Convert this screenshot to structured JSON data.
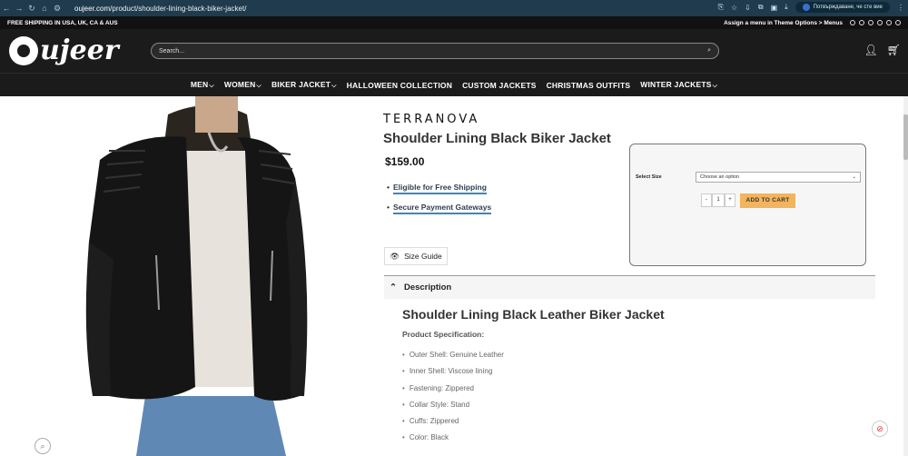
{
  "browser": {
    "url_host": "oujeer.com",
    "url_path": "/product/shoulder-lining-black-biker-jacket/",
    "profile_label": "Потвърждаване, че сте вие"
  },
  "topbar": {
    "shipping": "FREE SHIPPING IN USA, UK, CA & AUS",
    "menu_note": "Assign a menu in Theme Options > Menus"
  },
  "header": {
    "logo_text": "ujeer",
    "search_placeholder": "Search..."
  },
  "nav": {
    "items": [
      {
        "label": "MEN",
        "arrow": "⌵"
      },
      {
        "label": "WOMEN",
        "arrow": "⌵"
      },
      {
        "label": "BIKER JACKET",
        "arrow": "⌵"
      },
      {
        "label": "HALLOWEEN COLLECTION",
        "arrow": ""
      },
      {
        "label": "CUSTOM JACKETS",
        "arrow": ""
      },
      {
        "label": "CHRISTMAS OUTFITS",
        "arrow": ""
      },
      {
        "label": "WINTER JACKETS",
        "arrow": "⌵"
      }
    ]
  },
  "product": {
    "brand": "TERRANOVA",
    "title": "Shoulder Lining Black Biker Jacket",
    "price": "$159.00",
    "badges": [
      "Eligible for Free Shipping",
      "Secure Payment Gateways"
    ],
    "size_label": "Select Size",
    "size_placeholder": "Choose an option",
    "qty_minus": "-",
    "qty_value": "1",
    "qty_plus": "+",
    "add_to_cart": "ADD TO CART",
    "size_guide": "Size Guide"
  },
  "description": {
    "tab_label": "Description",
    "heading": "Shoulder Lining Black Leather Biker Jacket",
    "spec_heading": "Product Specification:",
    "specs": [
      "Outer Shell: Genuine Leather",
      "Inner Shell: Viscose lining",
      "Fastening: Zippered",
      "Collar Style: Stand",
      "Cuffs: Zippered",
      "Color: Black"
    ]
  },
  "colors": {
    "header_bg": "#1b1b1b",
    "chrome_bg": "#1f3b4d",
    "accent_button": "#f2b45c",
    "underline": "#3a86c5"
  }
}
